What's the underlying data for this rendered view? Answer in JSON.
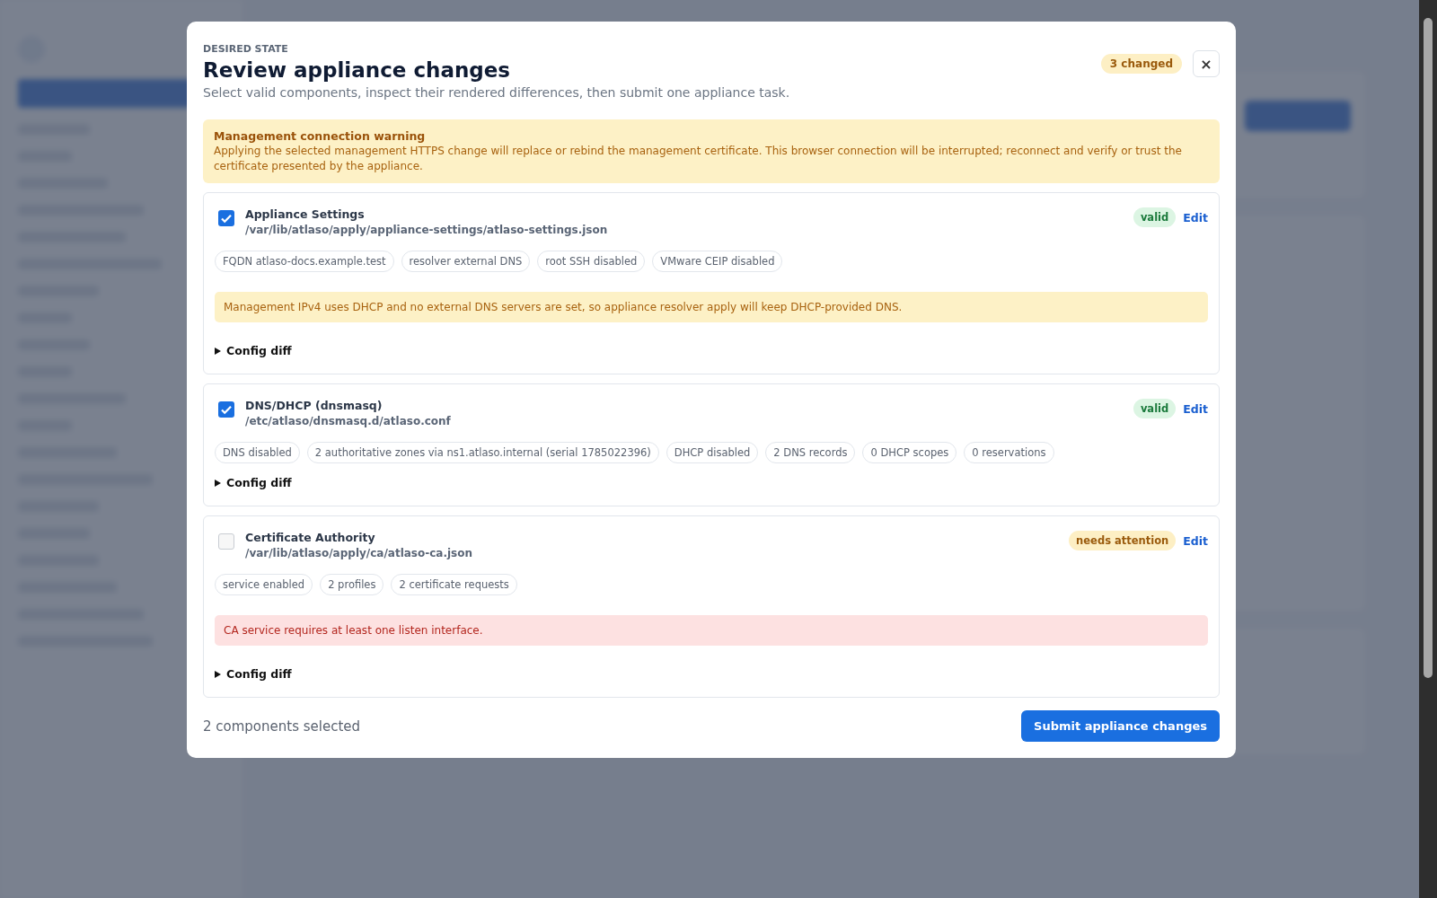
{
  "dialog": {
    "eyebrow": "DESIRED STATE",
    "title": "Review appliance changes",
    "subtitle": "Select valid components, inspect their rendered differences, then submit one appliance task.",
    "badge": "3 changed",
    "close": "×",
    "warning": {
      "title": "Management connection warning",
      "text": "Applying the selected management HTTPS change will replace or rebind the management certificate. This browser connection will be interrupted; reconnect and verify or trust the certificate presented by the appliance."
    },
    "components": [
      {
        "name": "Appliance Settings",
        "path": "/var/lib/atlaso/apply/appliance-settings/atlaso-settings.json",
        "checked": true,
        "status": "valid",
        "kind": "ok",
        "edit": "Edit",
        "tags": [
          "FQDN atlaso-docs.example.test",
          "resolver external DNS",
          "root SSH disabled",
          "VMware CEIP disabled"
        ],
        "notice": {
          "kind": "warning",
          "text": "Management IPv4 uses DHCP and no external DNS servers are set, so appliance resolver apply will keep DHCP-provided DNS."
        },
        "diff": "Config diff"
      },
      {
        "name": "DNS/DHCP (dnsmasq)",
        "path": "/etc/atlaso/dnsmasq.d/atlaso.conf",
        "checked": true,
        "status": "valid",
        "kind": "ok",
        "edit": "Edit",
        "tags": [
          "DNS disabled",
          "2 authoritative zones via ns1.atlaso.internal (serial 1785022396)",
          "DHCP disabled",
          "2 DNS records",
          "0 DHCP scopes",
          "0 reservations"
        ],
        "diff": "Config diff"
      },
      {
        "name": "Certificate Authority",
        "path": "/var/lib/atlaso/apply/ca/atlaso-ca.json",
        "checked": false,
        "status": "needs attention",
        "kind": "attention",
        "edit": "Edit",
        "tags": [
          "service enabled",
          "2 profiles",
          "2 certificate requests"
        ],
        "notice": {
          "kind": "error",
          "text": "CA service requires at least one listen interface."
        },
        "diff": "Config diff"
      }
    ],
    "footer": {
      "summary": "2 components selected",
      "submit": "Submit appliance changes"
    }
  }
}
